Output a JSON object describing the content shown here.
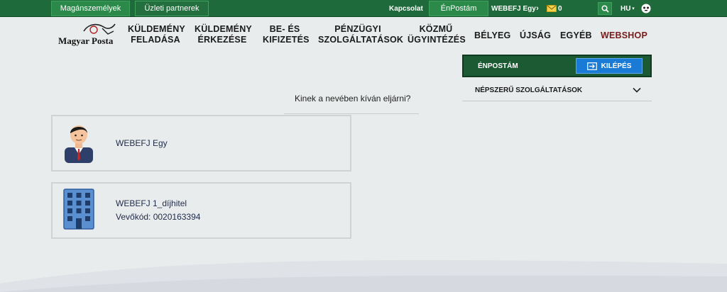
{
  "topbar": {
    "tab_private": "Magánszemélyek",
    "tab_business": "Üzleti partnerek",
    "contact": "Kapcsolat",
    "enpostam": "ÉnPostám",
    "user": "WEBEFJ Egy",
    "message_count": "0",
    "language": "HU"
  },
  "logo": {
    "text": "Magyar Posta"
  },
  "nav": {
    "items": [
      {
        "line1": "KÜLDEMÉNY",
        "line2": "FELADÁSA"
      },
      {
        "line1": "KÜLDEMÉNY",
        "line2": "ÉRKEZÉSE"
      },
      {
        "line1": "BE- ÉS",
        "line2": "KIFIZETÉS"
      },
      {
        "line1": "PÉNZÜGYI",
        "line2": "SZOLGÁLTATÁSOK"
      },
      {
        "line1": "KÖZMŰ",
        "line2": "ÜGYINTÉZÉS"
      },
      {
        "line1": "BÉLYEG",
        "line2": ""
      },
      {
        "line1": "ÚJSÁG",
        "line2": ""
      },
      {
        "line1": "EGYÉB",
        "line2": ""
      },
      {
        "line1": "WEBSHOP",
        "line2": ""
      }
    ]
  },
  "panel": {
    "title": "ÉNPOSTÁM",
    "exit_label": "KILÉPÉS",
    "popular_label": "NÉPSZERŰ SZOLGÁLTATÁSOK"
  },
  "main": {
    "question": "Kinek a nevében kíván eljárni?",
    "cards": [
      {
        "name": "WEBEFJ Egy",
        "sub": ""
      },
      {
        "name": "WEBEFJ 1_díjhitel",
        "sub": "Vevőkód: 0020163394"
      }
    ]
  },
  "colors": {
    "topbar": "#1e6a3a",
    "accent_blue": "#1a7bd6",
    "webshop": "#7a1b1b"
  }
}
